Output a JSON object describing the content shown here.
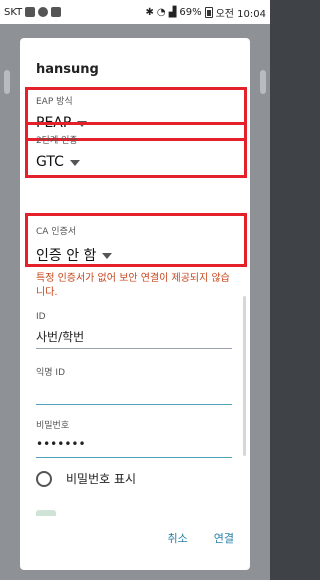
{
  "status_bar": {
    "carrier": "SKT",
    "battery_percent": "69%",
    "time": "오전 10:04"
  },
  "dialog": {
    "title": "hansung",
    "eap_method": {
      "label": "EAP 방식",
      "value": "PEAP"
    },
    "phase2": {
      "label": "2단계 인증",
      "value": "GTC"
    },
    "ca_cert": {
      "label": "CA 인증서",
      "value": "인증 안 함"
    },
    "warning": "특정 인증서가 없어 보안 연결이 제공되지 않습니다.",
    "identity": {
      "label": "ID",
      "value": "사번/학번"
    },
    "anonymous_identity": {
      "label": "익명 ID",
      "value": ""
    },
    "password": {
      "label": "비밀번호",
      "value": "•••••••"
    },
    "show_password": {
      "label": "비밀번호 표시",
      "checked": false
    },
    "buttons": {
      "cancel": "취소",
      "connect": "연결"
    }
  },
  "colors": {
    "highlight": "#e4202b",
    "warning": "#c8451a",
    "accent": "#2a7fa8"
  }
}
